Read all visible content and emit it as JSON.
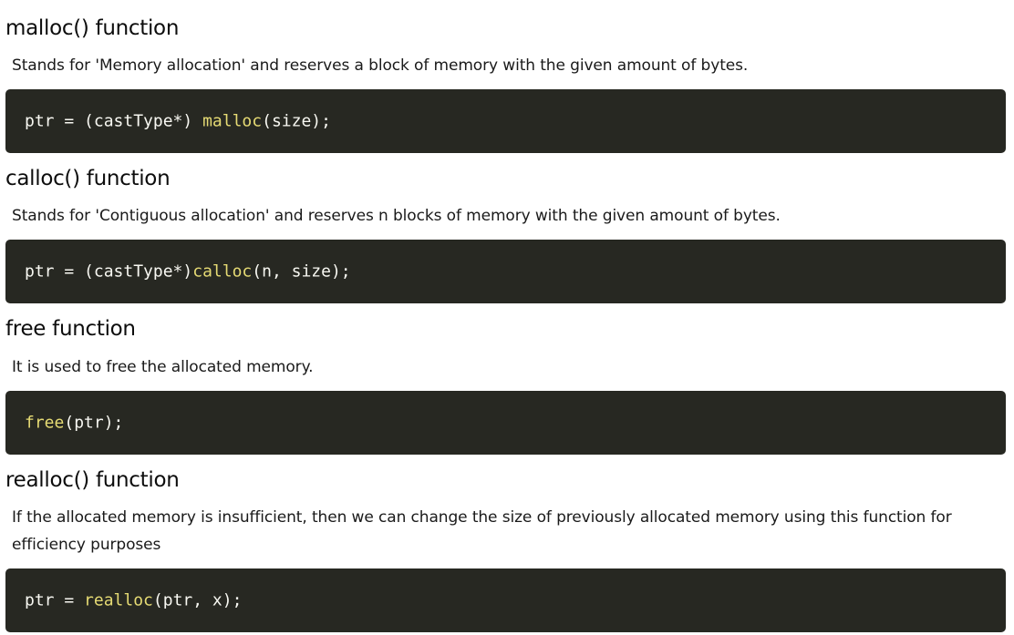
{
  "sections": [
    {
      "heading": "malloc() function",
      "description": "Stands for 'Memory allocation' and reserves a block of memory with the given amount of bytes.",
      "code": {
        "before": "ptr = (castType*) ",
        "fn": "malloc",
        "after": "(size);"
      }
    },
    {
      "heading": "calloc() function",
      "description": "Stands for 'Contiguous allocation' and reserves n blocks of memory with the given amount of bytes.",
      "code": {
        "before": "ptr = (castType*)",
        "fn": "calloc",
        "after": "(n, size);"
      }
    },
    {
      "heading": "free function",
      "description": "It is used to free the allocated memory.",
      "code": {
        "before": "",
        "fn": "free",
        "after": "(ptr);"
      }
    },
    {
      "heading": "realloc() function",
      "description": "If the allocated memory is insufficient, then we can change the size of previously allocated memory using this function for efficiency purposes",
      "code": {
        "before": "ptr = ",
        "fn": "realloc",
        "after": "(ptr, x);"
      }
    }
  ],
  "colors": {
    "code_background": "#272822",
    "code_text": "#f8f8f2",
    "code_function": "#e6db74"
  }
}
